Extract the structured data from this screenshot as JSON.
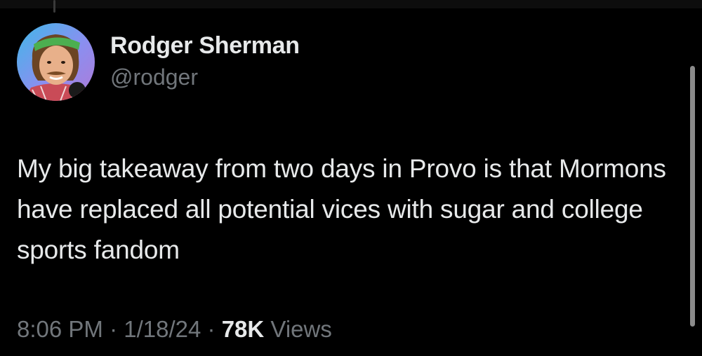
{
  "author": {
    "display_name": "Rodger Sherman",
    "handle": "@rodger"
  },
  "tweet": {
    "text": "My big takeaway from two days in Provo is that Mormons have replaced all potential vices with sugar and college sports fandom"
  },
  "meta": {
    "time": "8:06 PM",
    "date": "1/18/24",
    "separator": "·",
    "views_count": "78K",
    "views_label": "Views"
  },
  "colors": {
    "background": "#000000",
    "primary_text": "#e7e9ea",
    "secondary_text": "#71767b"
  }
}
